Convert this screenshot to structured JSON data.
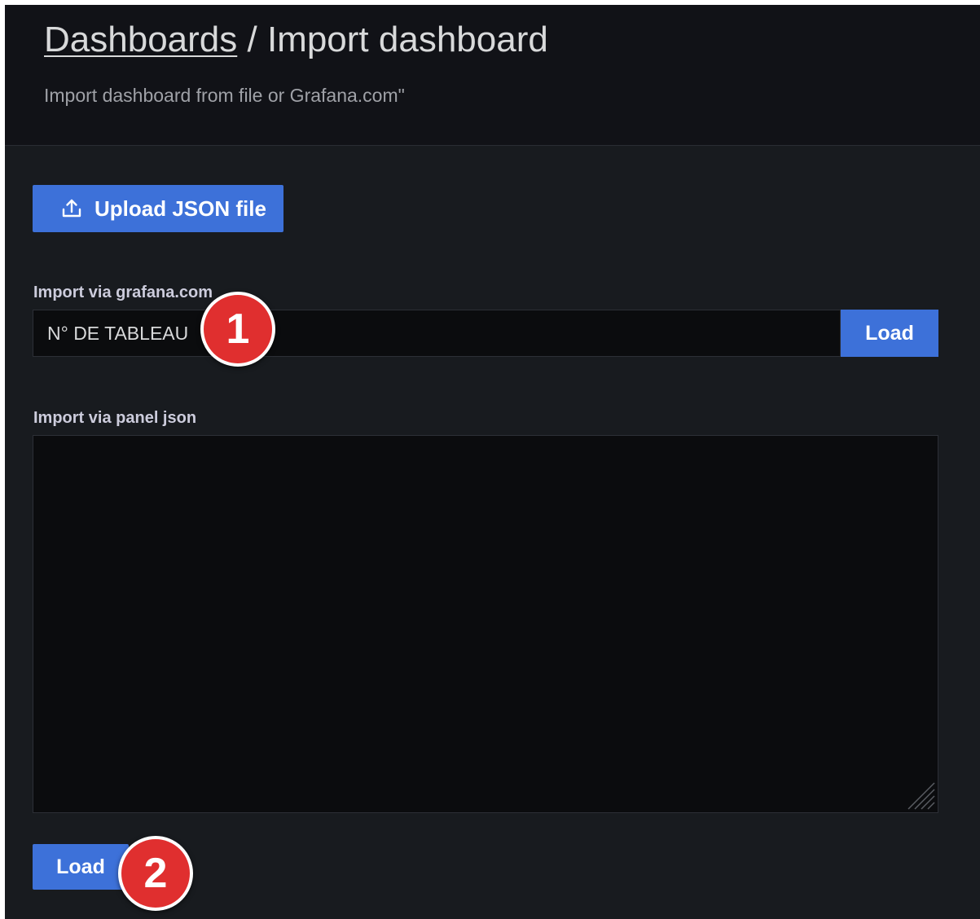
{
  "header": {
    "breadcrumb_link": "Dashboards",
    "separator": " / ",
    "title": "Import dashboard",
    "subtitle": "Import dashboard from file or Grafana.com\""
  },
  "upload": {
    "label": "Upload JSON file",
    "icon": "upload-icon"
  },
  "grafana_import": {
    "label": "Import via grafana.com",
    "input_value": "N° DE TABLEAU",
    "load_label": "Load"
  },
  "panel_json": {
    "label": "Import via panel json",
    "value": ""
  },
  "footer": {
    "load_label": "Load"
  },
  "annotations": {
    "badge_1": "1",
    "badge_2": "2"
  },
  "colors": {
    "accent": "#3d71d9",
    "badge": "#e02f2f",
    "background": "#181b1f",
    "header_background": "#111217"
  }
}
